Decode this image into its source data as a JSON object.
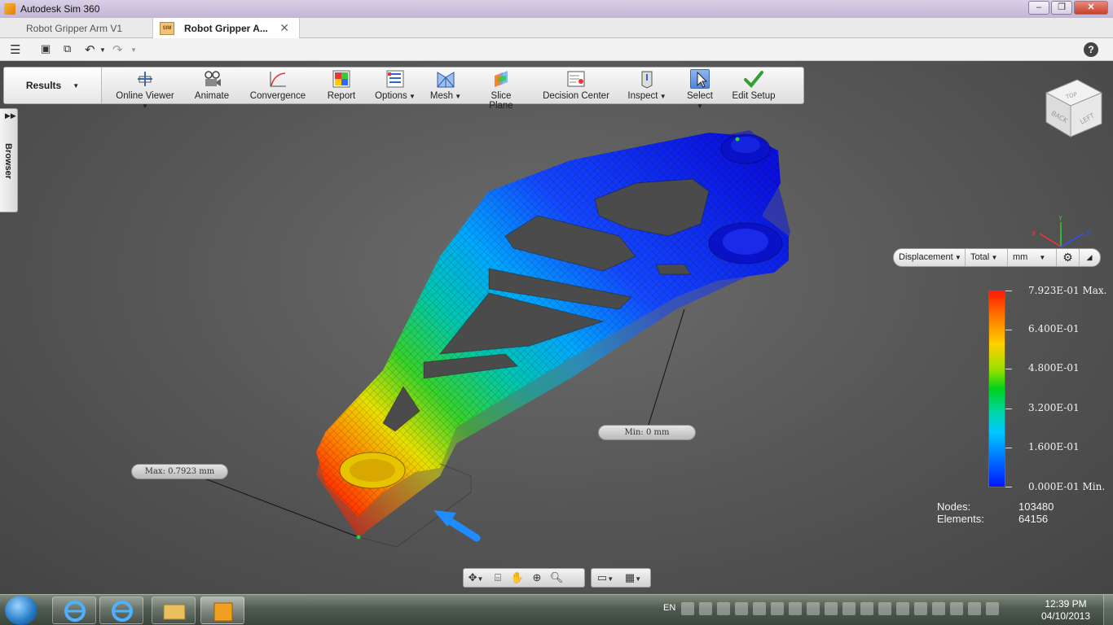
{
  "window": {
    "title": "Autodesk Sim 360",
    "buttons": [
      "–",
      "❐",
      "✕"
    ]
  },
  "doc_tabs": [
    {
      "label": "Robot Gripper Arm V1",
      "active": false
    },
    {
      "label": "Robot Gripper A...",
      "active": true,
      "icon_text": "SIM"
    }
  ],
  "ribbon": {
    "tab": "Results",
    "buttons": [
      {
        "label": "Online Viewer",
        "dropdown": true,
        "icon": "online-viewer-icon"
      },
      {
        "label": "Animate",
        "dropdown": false,
        "icon": "animate-icon"
      },
      {
        "label": "Convergence",
        "dropdown": false,
        "icon": "convergence-icon"
      },
      {
        "label": "Report",
        "dropdown": false,
        "icon": "report-icon"
      },
      {
        "label": "Options",
        "dropdown": true,
        "icon": "options-icon"
      },
      {
        "label": "Mesh",
        "dropdown": true,
        "icon": "mesh-icon"
      },
      {
        "label": "Slice Plane",
        "dropdown": false,
        "icon": "slice-plane-icon"
      },
      {
        "label": "Decision Center",
        "dropdown": false,
        "icon": "decision-center-icon"
      },
      {
        "label": "Inspect",
        "dropdown": true,
        "icon": "inspect-icon"
      },
      {
        "label": "Select",
        "dropdown": true,
        "icon": "select-cursor-icon",
        "selected": true
      },
      {
        "label": "Edit Setup",
        "dropdown": false,
        "icon": "checkmark-icon"
      }
    ]
  },
  "browser": {
    "label": "Browser"
  },
  "viewcube": {
    "faces": [
      "BACK",
      "LEFT",
      "TOP"
    ]
  },
  "result_controls": {
    "quantity": "Displacement",
    "component": "Total",
    "unit": "mm"
  },
  "legend": {
    "labels": [
      "7.923E-01 Max.",
      "6.400E-01",
      "4.800E-01",
      "3.200E-01",
      "1.600E-01",
      "0.000E-01 Min."
    ],
    "colors": {
      "max": "#ff1a00",
      "min": "#0018ff"
    }
  },
  "stats": {
    "nodes_label": "Nodes:",
    "nodes_value": "103480",
    "elements_label": "Elements:",
    "elements_value": "64156"
  },
  "callouts": {
    "max": "Max: 0.7923 mm",
    "min": "Min: 0 mm"
  },
  "taskbar": {
    "language": "EN",
    "time": "12:39 PM",
    "date": "04/10/2013"
  }
}
